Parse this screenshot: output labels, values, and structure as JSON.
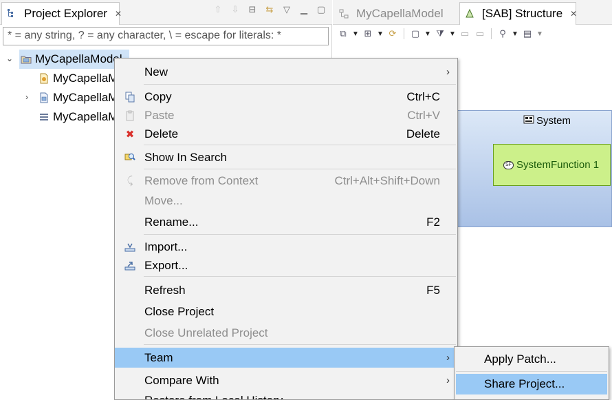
{
  "project_explorer": {
    "tab_label": "Project Explorer",
    "filter_placeholder": "* = any string, ? = any character, \\ = escape for literals: *",
    "tree": [
      {
        "label": "MyCapellaModel",
        "expanded": true,
        "selected": true,
        "icon": "project-folder-icon"
      },
      {
        "label": "MyCapellaM",
        "icon": "aird-file-icon"
      },
      {
        "label": "MyCapellaM",
        "icon": "capella-model-icon",
        "collapsed": true
      },
      {
        "label": "MyCapellaM",
        "icon": "afm-file-icon"
      }
    ]
  },
  "editor": {
    "tabs": [
      {
        "label": "MyCapellaModel",
        "active": false
      },
      {
        "label": "[SAB] Structure",
        "active": true
      }
    ],
    "diagram": {
      "system_label": "System",
      "function_label": "SystemFunction 1",
      "function_badge": "SF"
    }
  },
  "context_menu": {
    "items": [
      {
        "label": "New",
        "submenu": true
      },
      {
        "label": "Copy",
        "accel": "Ctrl+C",
        "icon": "copy-icon"
      },
      {
        "label": "Paste",
        "accel": "Ctrl+V",
        "icon": "paste-icon",
        "disabled": true
      },
      {
        "label": "Delete",
        "accel": "Delete",
        "icon": "delete-icon"
      },
      {
        "label": "Show In Search",
        "icon": "search-icon"
      },
      {
        "label": "Remove from Context",
        "accel": "Ctrl+Alt+Shift+Down",
        "icon": "remove-icon",
        "disabled": true
      },
      {
        "label": "Move...",
        "disabled": true
      },
      {
        "label": "Rename...",
        "accel": "F2"
      },
      {
        "label": "Import...",
        "icon": "import-icon"
      },
      {
        "label": "Export...",
        "icon": "export-icon"
      },
      {
        "label": "Refresh",
        "accel": "F5"
      },
      {
        "label": "Close Project"
      },
      {
        "label": "Close Unrelated Project",
        "disabled": true
      },
      {
        "label": "Team",
        "submenu": true,
        "highlighted": true
      },
      {
        "label": "Compare With",
        "submenu": true
      },
      {
        "label": "Restore from Local History"
      }
    ]
  },
  "team_submenu": {
    "items": [
      {
        "label": "Apply Patch..."
      },
      {
        "label": "Share Project...",
        "highlighted": true
      }
    ]
  },
  "colors": {
    "menu_highlight": "#99c9f5",
    "selection": "#cfe3f7",
    "function_fill": "#ccf08a",
    "system_fill_top": "#dce8f7",
    "system_fill_bottom": "#a9c1e6"
  }
}
